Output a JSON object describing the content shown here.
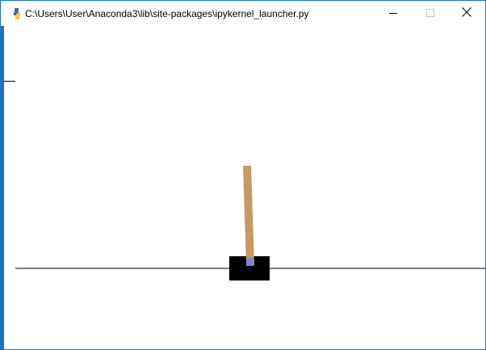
{
  "window": {
    "title": "C:\\Users\\User\\Anaconda3\\lib\\site-packages\\ipykernel_launcher.py",
    "icon": "python-icon",
    "controls": {
      "minimize": "minimize-icon",
      "maximize": "maximize-icon",
      "close": "close-icon"
    }
  },
  "scene": {
    "track_color": "#000000",
    "cart_color": "#000000",
    "pole_color": "#ca9865",
    "axle_color": "#8184cb",
    "background": "#ffffff"
  }
}
